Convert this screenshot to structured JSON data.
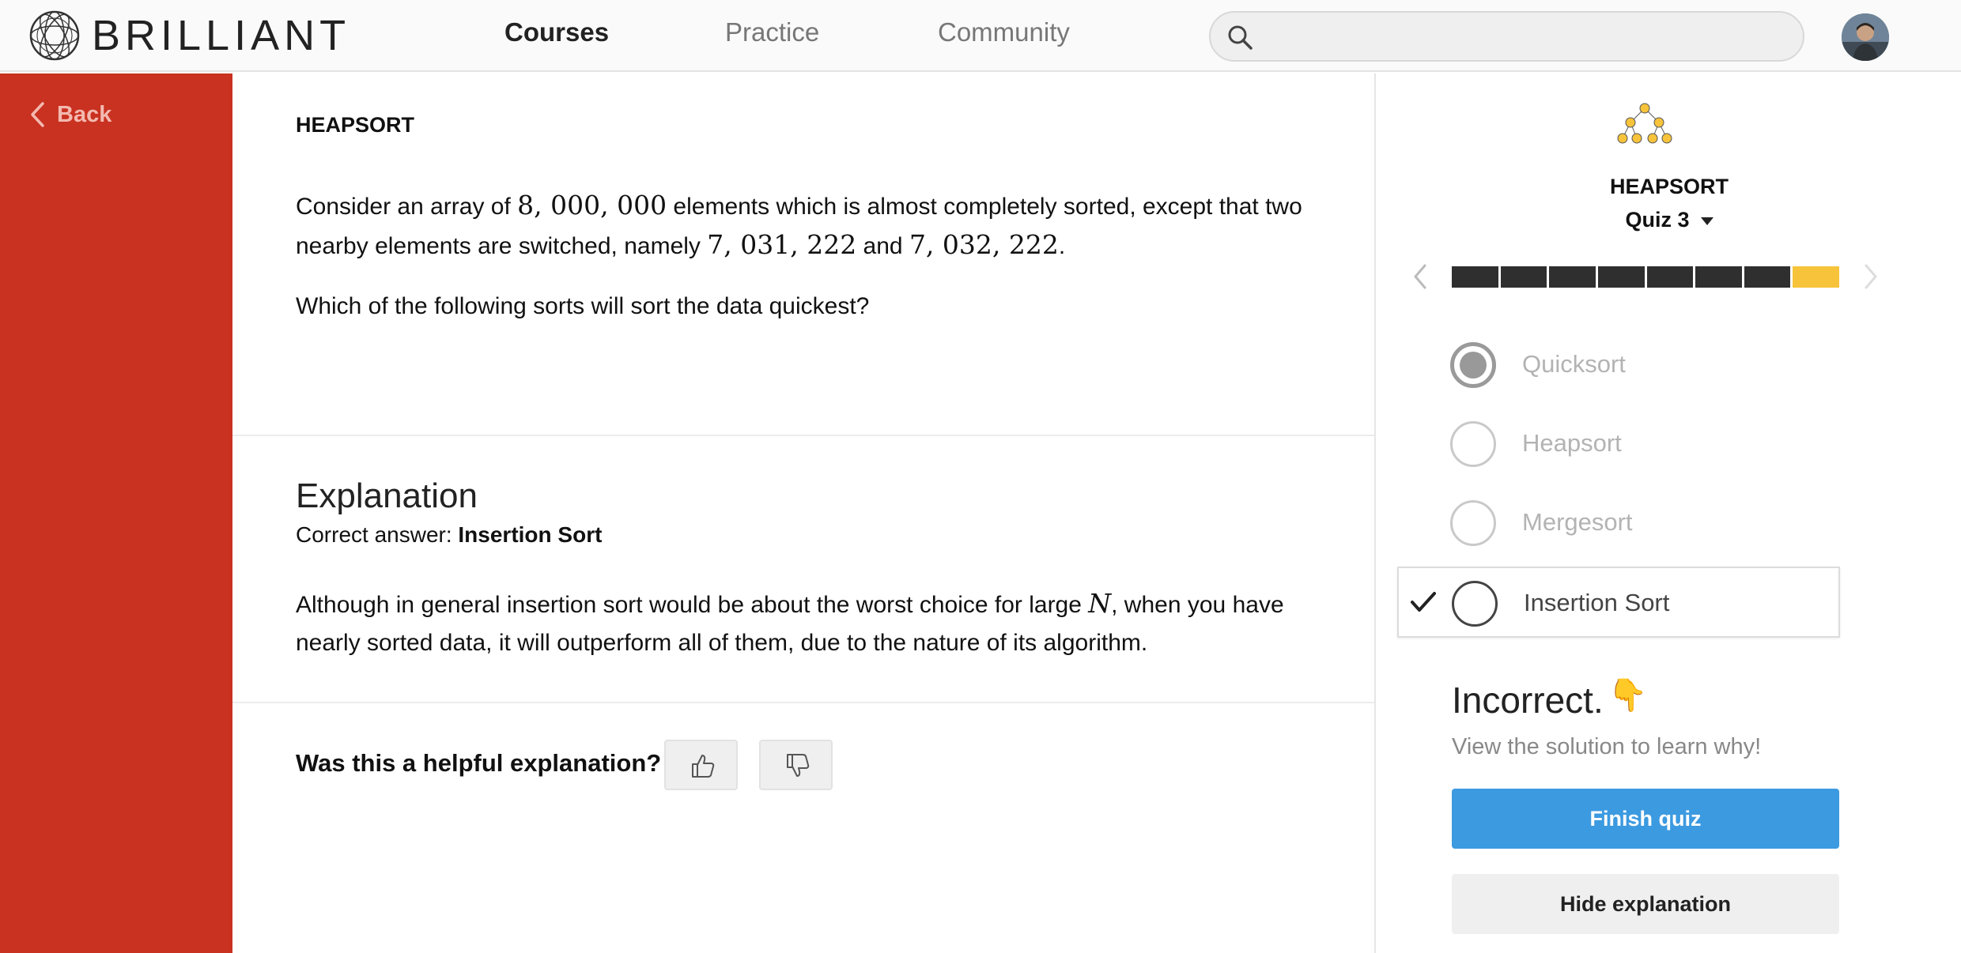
{
  "header": {
    "brand": "BRILLIANT",
    "nav": [
      {
        "label": "Courses",
        "active": true
      },
      {
        "label": "Practice",
        "active": false
      },
      {
        "label": "Community",
        "active": false
      }
    ],
    "search": {
      "placeholder": "",
      "value": ""
    }
  },
  "sidebar": {
    "back_label": "Back"
  },
  "problem": {
    "course": "HEAPSORT",
    "text_1": "Consider an array of ",
    "math_1": "8, 000, 000",
    "text_2": " elements which is almost completely sorted, except that two nearby elements are switched, namely ",
    "math_2": "7, 031, 222",
    "text_3": " and ",
    "math_3": "7, 032, 222",
    "text_4": ".",
    "question": "Which of the following sorts will sort the data quickest?"
  },
  "explanation": {
    "title": "Explanation",
    "correct_prefix": "Correct answer: ",
    "correct_answer": "Insertion Sort",
    "text_1": "Although in general insertion sort would be about the worst choice for large ",
    "math_1": "N",
    "text_2": ", when you have nearly sorted data, it will outperform all of them, due to the nature of its algorithm.",
    "feedback_prompt": "Was this a helpful explanation?"
  },
  "quiz_panel": {
    "course": "HEAPSORT",
    "quiz_label": "Quiz 3",
    "progress": {
      "total": 8,
      "current": 8
    },
    "choices": [
      {
        "label": "Quicksort",
        "state": "selected"
      },
      {
        "label": "Heapsort",
        "state": "none"
      },
      {
        "label": "Mergesort",
        "state": "none"
      },
      {
        "label": "Insertion Sort",
        "state": "correct"
      }
    ],
    "result_title": "Incorrect.",
    "result_emoji": "👇",
    "result_hint": "View the solution to learn why!",
    "finish_label": "Finish quiz",
    "hide_label": "Hide explanation"
  },
  "colors": {
    "sidebar": "#c93120",
    "primary_button": "#3c9ae0",
    "progress_done": "#2f2f2f",
    "progress_current": "#f6c33a"
  }
}
